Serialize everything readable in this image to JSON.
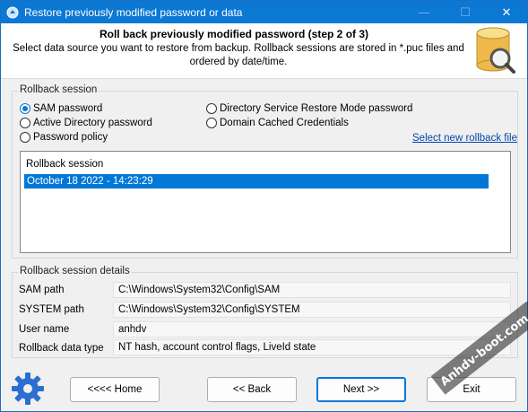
{
  "window": {
    "title": "Restore previously modified password or data",
    "minimize": "—",
    "maximize": "☐",
    "close": "✕"
  },
  "header": {
    "title": "Roll back previously modified password (step 2 of 3)",
    "description": "Select data source you want to restore from backup. Rollback sessions are stored in *.puc files and ordered by date/time."
  },
  "rollback_session": {
    "group_label": "Rollback session",
    "options": [
      {
        "label": "SAM password",
        "checked": true
      },
      {
        "label": "Active Directory password",
        "checked": false
      },
      {
        "label": "Password policy",
        "checked": false
      },
      {
        "label": "Directory Service Restore Mode password",
        "checked": false
      },
      {
        "label": "Domain Cached Credentials",
        "checked": false
      }
    ],
    "select_link": "Select new rollback file",
    "list_header": "Rollback session",
    "list_items": [
      "October 18 2022  -  14:23:29"
    ]
  },
  "details": {
    "group_label": "Rollback session details",
    "rows": [
      {
        "label": "SAM path",
        "value": "C:\\Windows\\System32\\Config\\SAM"
      },
      {
        "label": "SYSTEM path",
        "value": "C:\\Windows\\System32\\Config\\SYSTEM"
      },
      {
        "label": "User name",
        "value": "anhdv"
      },
      {
        "label": "Rollback data type",
        "value": "NT hash, account control flags, LiveId state"
      }
    ]
  },
  "footer": {
    "home": "<<<< Home",
    "back": "<< Back",
    "next": "Next >>",
    "exit": "Exit"
  },
  "watermark": {
    "text": "Anhdv-boot.com"
  },
  "colors": {
    "titlebar": "#0b78d4",
    "selection": "#0078d7",
    "link": "#0645ad"
  }
}
